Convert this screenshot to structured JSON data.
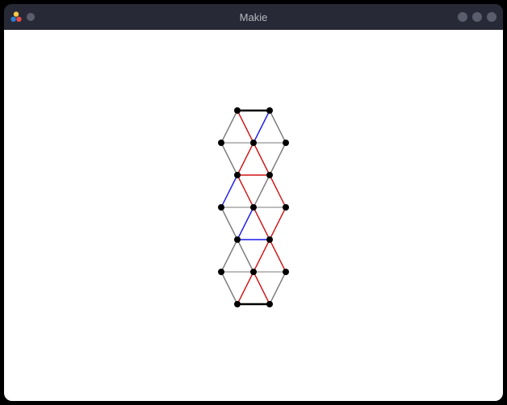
{
  "window": {
    "title": "Makie",
    "app_icon_name": "makie-logo"
  },
  "chart_data": {
    "type": "graph",
    "title": "",
    "xlabel": "",
    "ylabel": "",
    "axes_visible": false,
    "palette": {
      "black": "#000000",
      "red": "#d11414",
      "blue": "#1a1ae6",
      "gray": "#7a7a7a"
    },
    "node_radius": 4,
    "nodes": [
      {
        "id": 0,
        "x": 0.0,
        "y": 0.0
      },
      {
        "id": 1,
        "x": 1.0,
        "y": 0.0
      },
      {
        "id": 2,
        "x": -0.5,
        "y": 1.0
      },
      {
        "id": 3,
        "x": 0.5,
        "y": 1.0
      },
      {
        "id": 4,
        "x": 1.5,
        "y": 1.0
      },
      {
        "id": 5,
        "x": 0.0,
        "y": 2.0
      },
      {
        "id": 6,
        "x": 1.0,
        "y": 2.0
      },
      {
        "id": 7,
        "x": -0.5,
        "y": 3.0
      },
      {
        "id": 8,
        "x": 0.5,
        "y": 3.0
      },
      {
        "id": 9,
        "x": 1.5,
        "y": 3.0
      },
      {
        "id": 10,
        "x": 0.0,
        "y": 4.0
      },
      {
        "id": 11,
        "x": 1.0,
        "y": 4.0
      },
      {
        "id": 12,
        "x": -0.5,
        "y": 5.0
      },
      {
        "id": 13,
        "x": 0.5,
        "y": 5.0
      },
      {
        "id": 14,
        "x": 1.5,
        "y": 5.0
      },
      {
        "id": 15,
        "x": 0.0,
        "y": 6.0
      },
      {
        "id": 16,
        "x": 1.0,
        "y": 6.0
      }
    ],
    "edges": [
      {
        "a": 0,
        "b": 1,
        "color": "black",
        "w": 2.5
      },
      {
        "a": 0,
        "b": 2,
        "color": "gray",
        "w": 1.4
      },
      {
        "a": 0,
        "b": 3,
        "color": "red",
        "w": 1.4
      },
      {
        "a": 1,
        "b": 3,
        "color": "blue",
        "w": 1.4
      },
      {
        "a": 1,
        "b": 4,
        "color": "gray",
        "w": 1.4
      },
      {
        "a": 2,
        "b": 3,
        "color": "gray",
        "w": 1.0
      },
      {
        "a": 3,
        "b": 4,
        "color": "gray",
        "w": 1.0
      },
      {
        "a": 2,
        "b": 5,
        "color": "gray",
        "w": 1.4
      },
      {
        "a": 3,
        "b": 5,
        "color": "red",
        "w": 1.4
      },
      {
        "a": 3,
        "b": 6,
        "color": "red",
        "w": 1.4
      },
      {
        "a": 4,
        "b": 6,
        "color": "gray",
        "w": 1.4
      },
      {
        "a": 5,
        "b": 6,
        "color": "red",
        "w": 1.4
      },
      {
        "a": 5,
        "b": 7,
        "color": "blue",
        "w": 1.4
      },
      {
        "a": 5,
        "b": 8,
        "color": "red",
        "w": 1.4
      },
      {
        "a": 6,
        "b": 8,
        "color": "gray",
        "w": 1.4
      },
      {
        "a": 6,
        "b": 9,
        "color": "red",
        "w": 1.4
      },
      {
        "a": 7,
        "b": 8,
        "color": "gray",
        "w": 1.0
      },
      {
        "a": 8,
        "b": 9,
        "color": "gray",
        "w": 1.0
      },
      {
        "a": 7,
        "b": 10,
        "color": "gray",
        "w": 1.4
      },
      {
        "a": 8,
        "b": 10,
        "color": "blue",
        "w": 1.4
      },
      {
        "a": 8,
        "b": 11,
        "color": "red",
        "w": 1.4
      },
      {
        "a": 9,
        "b": 11,
        "color": "red",
        "w": 1.4
      },
      {
        "a": 10,
        "b": 11,
        "color": "blue",
        "w": 1.4
      },
      {
        "a": 10,
        "b": 12,
        "color": "gray",
        "w": 1.4
      },
      {
        "a": 10,
        "b": 13,
        "color": "gray",
        "w": 1.4
      },
      {
        "a": 11,
        "b": 13,
        "color": "red",
        "w": 1.4
      },
      {
        "a": 11,
        "b": 14,
        "color": "red",
        "w": 1.4
      },
      {
        "a": 12,
        "b": 13,
        "color": "gray",
        "w": 1.0
      },
      {
        "a": 13,
        "b": 14,
        "color": "gray",
        "w": 1.0
      },
      {
        "a": 12,
        "b": 15,
        "color": "gray",
        "w": 1.4
      },
      {
        "a": 13,
        "b": 15,
        "color": "red",
        "w": 1.4
      },
      {
        "a": 13,
        "b": 16,
        "color": "red",
        "w": 1.4
      },
      {
        "a": 14,
        "b": 16,
        "color": "gray",
        "w": 1.4
      },
      {
        "a": 15,
        "b": 16,
        "color": "black",
        "w": 2.5
      }
    ]
  }
}
